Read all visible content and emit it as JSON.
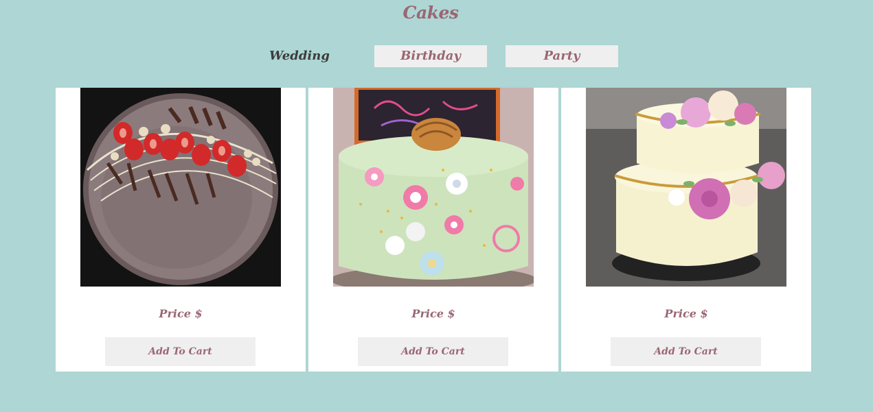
{
  "page": {
    "title": "Cakes"
  },
  "tabs": [
    {
      "label": "Wedding",
      "active": true
    },
    {
      "label": "Birthday",
      "active": false
    },
    {
      "label": "Party",
      "active": false
    }
  ],
  "products": [
    {
      "image": "chocolate-tart-with-strawberries-photo",
      "price_label": "Price $",
      "button_label": "Add To Cart"
    },
    {
      "image": "mint-floral-birthday-cake-photo",
      "price_label": "Price $",
      "button_label": "Add To Cart"
    },
    {
      "image": "two-tier-cream-wedding-cake-photo",
      "price_label": "Price $",
      "button_label": "Add To Cart"
    }
  ],
  "colors": {
    "background": "#add6d4",
    "accent": "#9a6672",
    "active_tab_text": "#3c3c3c",
    "button_background": "#efefef",
    "card_background": "#ffffff"
  }
}
